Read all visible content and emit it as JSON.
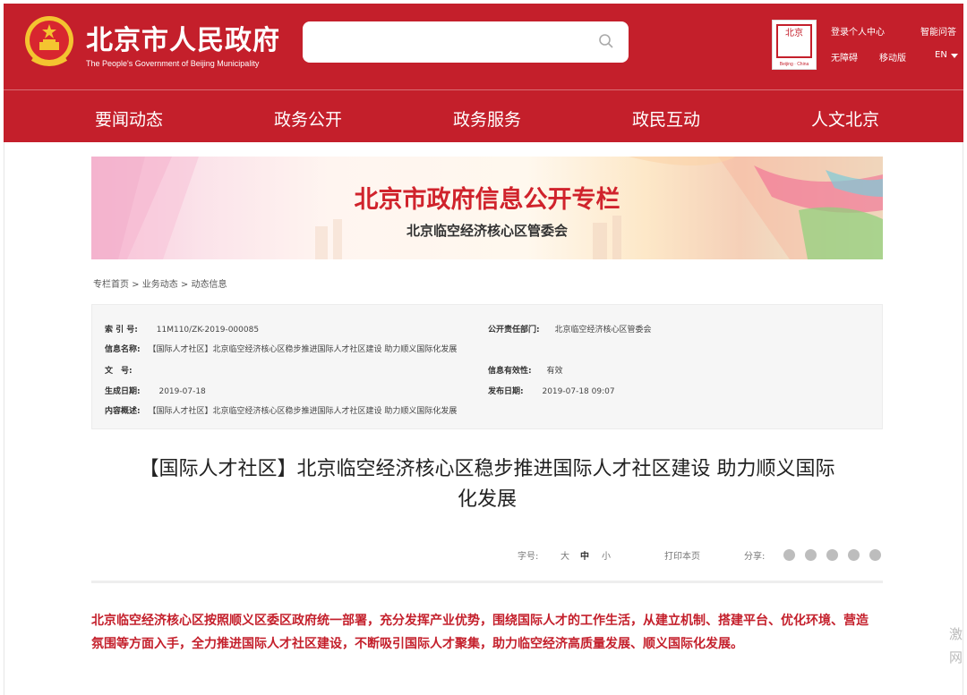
{
  "header": {
    "title": "北京市人民政府",
    "subtitle": "The People's Government of Beijing Municipality",
    "search": {
      "placeholder": ""
    },
    "logo_caption": "Beijing · China",
    "logo_glyph": "北京",
    "links": [
      "登录个人中心",
      "智能问答",
      "无障碍",
      "移动版",
      "EN"
    ]
  },
  "nav": [
    "要闻动态",
    "政务公开",
    "政务服务",
    "政民互动",
    "人文北京"
  ],
  "banner": {
    "title": "北京市政府信息公开专栏",
    "subtitle": "北京临空经济核心区管委会"
  },
  "breadcrumb": "专栏首页 > 业务动态 > 动态信息",
  "info": {
    "index_label": "索 引 号:",
    "index_value": "11M110/ZK-2019-000085",
    "dept_label": "公开责任部门:",
    "dept_value": "北京临空经济核心区管委会",
    "name_label": "信息名称:",
    "name_value": "【国际人才社区】北京临空经济核心区稳步推进国际人才社区建设 助力顺义国际化发展",
    "doc_label": "文　号:",
    "doc_value": "",
    "valid_label": "信息有效性:",
    "valid_value": "有效",
    "created_label": "生成日期:",
    "created_value": "2019-07-18",
    "published_label": "发布日期:",
    "published_value": "2019-07-18 09:07",
    "summary_label": "内容概述:",
    "summary_value": "【国际人才社区】北京临空经济核心区稳步推进国际人才社区建设 助力顺义国际化发展"
  },
  "article": {
    "title_line1": "【国际人才社区】北京临空经济核心区稳步推进国际人才社区建设 助力顺义国际",
    "title_line2": "化发展",
    "font_label": "字号:",
    "font_large": "大",
    "font_medium": "中",
    "font_small": "小",
    "print_label": "打印本页",
    "share_label": "分享:",
    "lead": "北京临空经济核心区按照顺义区委区政府统一部署，充分发挥产业优势，围绕国际人才的工作生活，从建立机制、搭建平台、优化环境、营造氛围等方面入手，全力推进国际人才社区建设，不断吸引国际人才聚集，助力临空经济高质量发展、顺义国际化发展。"
  },
  "watermark": "激 网",
  "colors": {
    "brand_red": "#c41f2b",
    "banner_title_red": "#d0232c"
  }
}
